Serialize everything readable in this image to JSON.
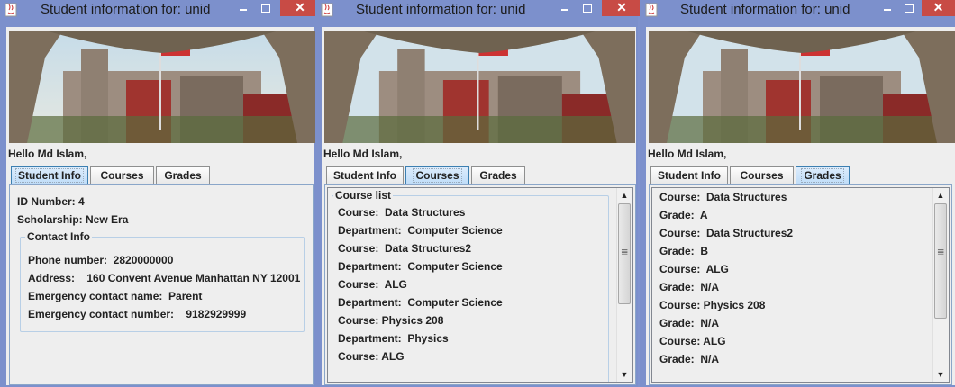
{
  "window_title": "Student information for: unid",
  "greeting": "Hello Md Islam,",
  "tabs": [
    "Student Info",
    "Courses",
    "Grades"
  ],
  "close_glyph": "✕",
  "student_info": {
    "id_number": "ID Number: 4",
    "scholarship": "Scholarship: New Era",
    "contact_legend": "Contact Info",
    "phone": "Phone number:  2820000000",
    "address": "Address:    160 Convent Avenue Manhattan NY 12001",
    "emergency_name": "Emergency contact name:  Parent",
    "emergency_number": "Emergency contact number:    9182929999"
  },
  "courses": {
    "legend": "Course list",
    "lines": [
      "Course:  Data Structures",
      "Department:  Computer Science",
      "Course:  Data Structures2",
      "Department:  Computer Science",
      "Course:  ALG",
      "Department:  Computer Science",
      "Course: Physics 208",
      "Department:  Physics",
      "Course: ALG"
    ]
  },
  "grades": {
    "lines": [
      "Course:  Data Structures",
      "Grade:  A",
      "Course:  Data Structures2",
      "Grade:  B",
      "Course:  ALG",
      "Grade:  N/A",
      "Course: Physics 208",
      "Grade:  N/A",
      "Course: ALG",
      "Grade:  N/A"
    ]
  },
  "icons": {
    "app": "java-icon",
    "minimize": "minimize-icon",
    "maximize": "maximize-icon",
    "close": "close-icon",
    "scroll_up": "arrow-up-icon",
    "scroll_down": "arrow-down-icon"
  },
  "colors": {
    "title_bar": "#7c90cc",
    "close_button": "#c84b45",
    "active_tab": "#bedcf8",
    "panel_border": "#8aa6c9"
  }
}
